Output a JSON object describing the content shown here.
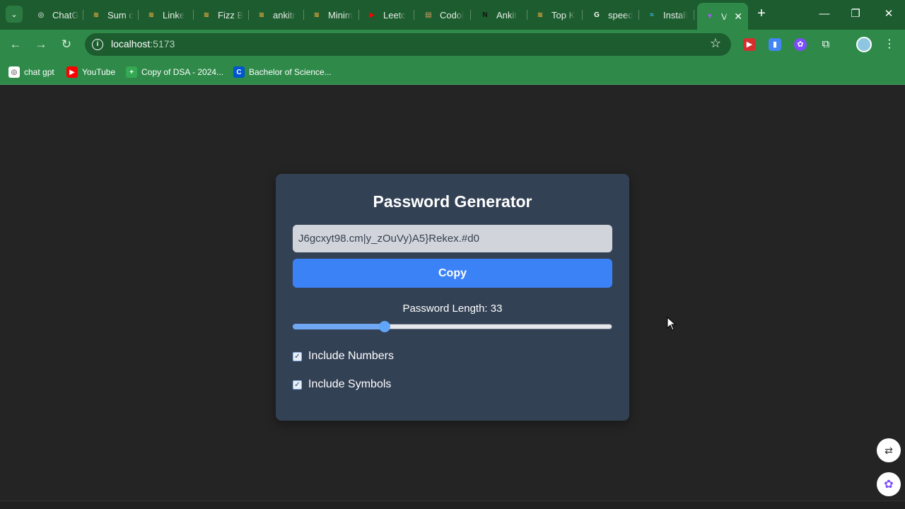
{
  "browser": {
    "tabs": [
      {
        "label": "ChatG",
        "favicon": "chatgpt-icon",
        "color": "#ffffff",
        "glyph": "◎"
      },
      {
        "label": "Sum c",
        "favicon": "code-icon",
        "color": "#f5b041",
        "glyph": "≋"
      },
      {
        "label": "Linke",
        "favicon": "code-icon",
        "color": "#f5b041",
        "glyph": "≋"
      },
      {
        "label": "Fizz B",
        "favicon": "code-icon",
        "color": "#f5b041",
        "glyph": "≋"
      },
      {
        "label": "ankitr",
        "favicon": "code-icon",
        "color": "#f5b041",
        "glyph": "≋"
      },
      {
        "label": "Minim",
        "favicon": "code-icon",
        "color": "#f5b041",
        "glyph": "≋"
      },
      {
        "label": "Leetc",
        "favicon": "youtube-icon",
        "color": "#ff0000",
        "glyph": "▶"
      },
      {
        "label": "Codol",
        "favicon": "codolio-icon",
        "color": "#d9a066",
        "glyph": "▤"
      },
      {
        "label": "Ankit",
        "favicon": "naukri-icon",
        "color": "#111111",
        "glyph": "N"
      },
      {
        "label": "Top K",
        "favicon": "code-icon",
        "color": "#f5b041",
        "glyph": "≋"
      },
      {
        "label": "speed",
        "favicon": "google-icon",
        "color": "#ffffff",
        "glyph": "G"
      },
      {
        "label": "Install",
        "favicon": "tailwind-icon",
        "color": "#38bdf8",
        "glyph": "≈"
      },
      {
        "label": "V",
        "favicon": "vite-icon",
        "color": "#a855f7",
        "glyph": "▼"
      }
    ],
    "url_host": "localhost",
    "url_port": ":5173",
    "bookmarks": [
      {
        "label": "chat gpt",
        "favicon": "chatgpt-icon",
        "color": "#ffffff",
        "glyph": "◎"
      },
      {
        "label": "YouTube",
        "favicon": "youtube-icon",
        "color": "#ff0000",
        "glyph": "▶"
      },
      {
        "label": "Copy of DSA - 2024...",
        "favicon": "sheets-icon",
        "color": "#34a853",
        "glyph": "+"
      },
      {
        "label": "Bachelor of Science...",
        "favicon": "coursera-icon",
        "color": "#0056d2",
        "glyph": "C"
      }
    ]
  },
  "app": {
    "title": "Password Generator",
    "password": "J6gcxyt98.cm|y_zOuVy)A5}Rekex.#d0",
    "copy_label": "Copy",
    "length_label": "Password Length: 33",
    "length_value": 33,
    "length_min": 6,
    "length_max": 100,
    "options": [
      {
        "label": "Include Numbers",
        "checked": true
      },
      {
        "label": "Include Symbols",
        "checked": true
      }
    ]
  },
  "colors": {
    "page_bg": "#242424",
    "card_bg": "#334155",
    "button": "#3b82f6",
    "browser_frame": "#2f8a4a"
  }
}
